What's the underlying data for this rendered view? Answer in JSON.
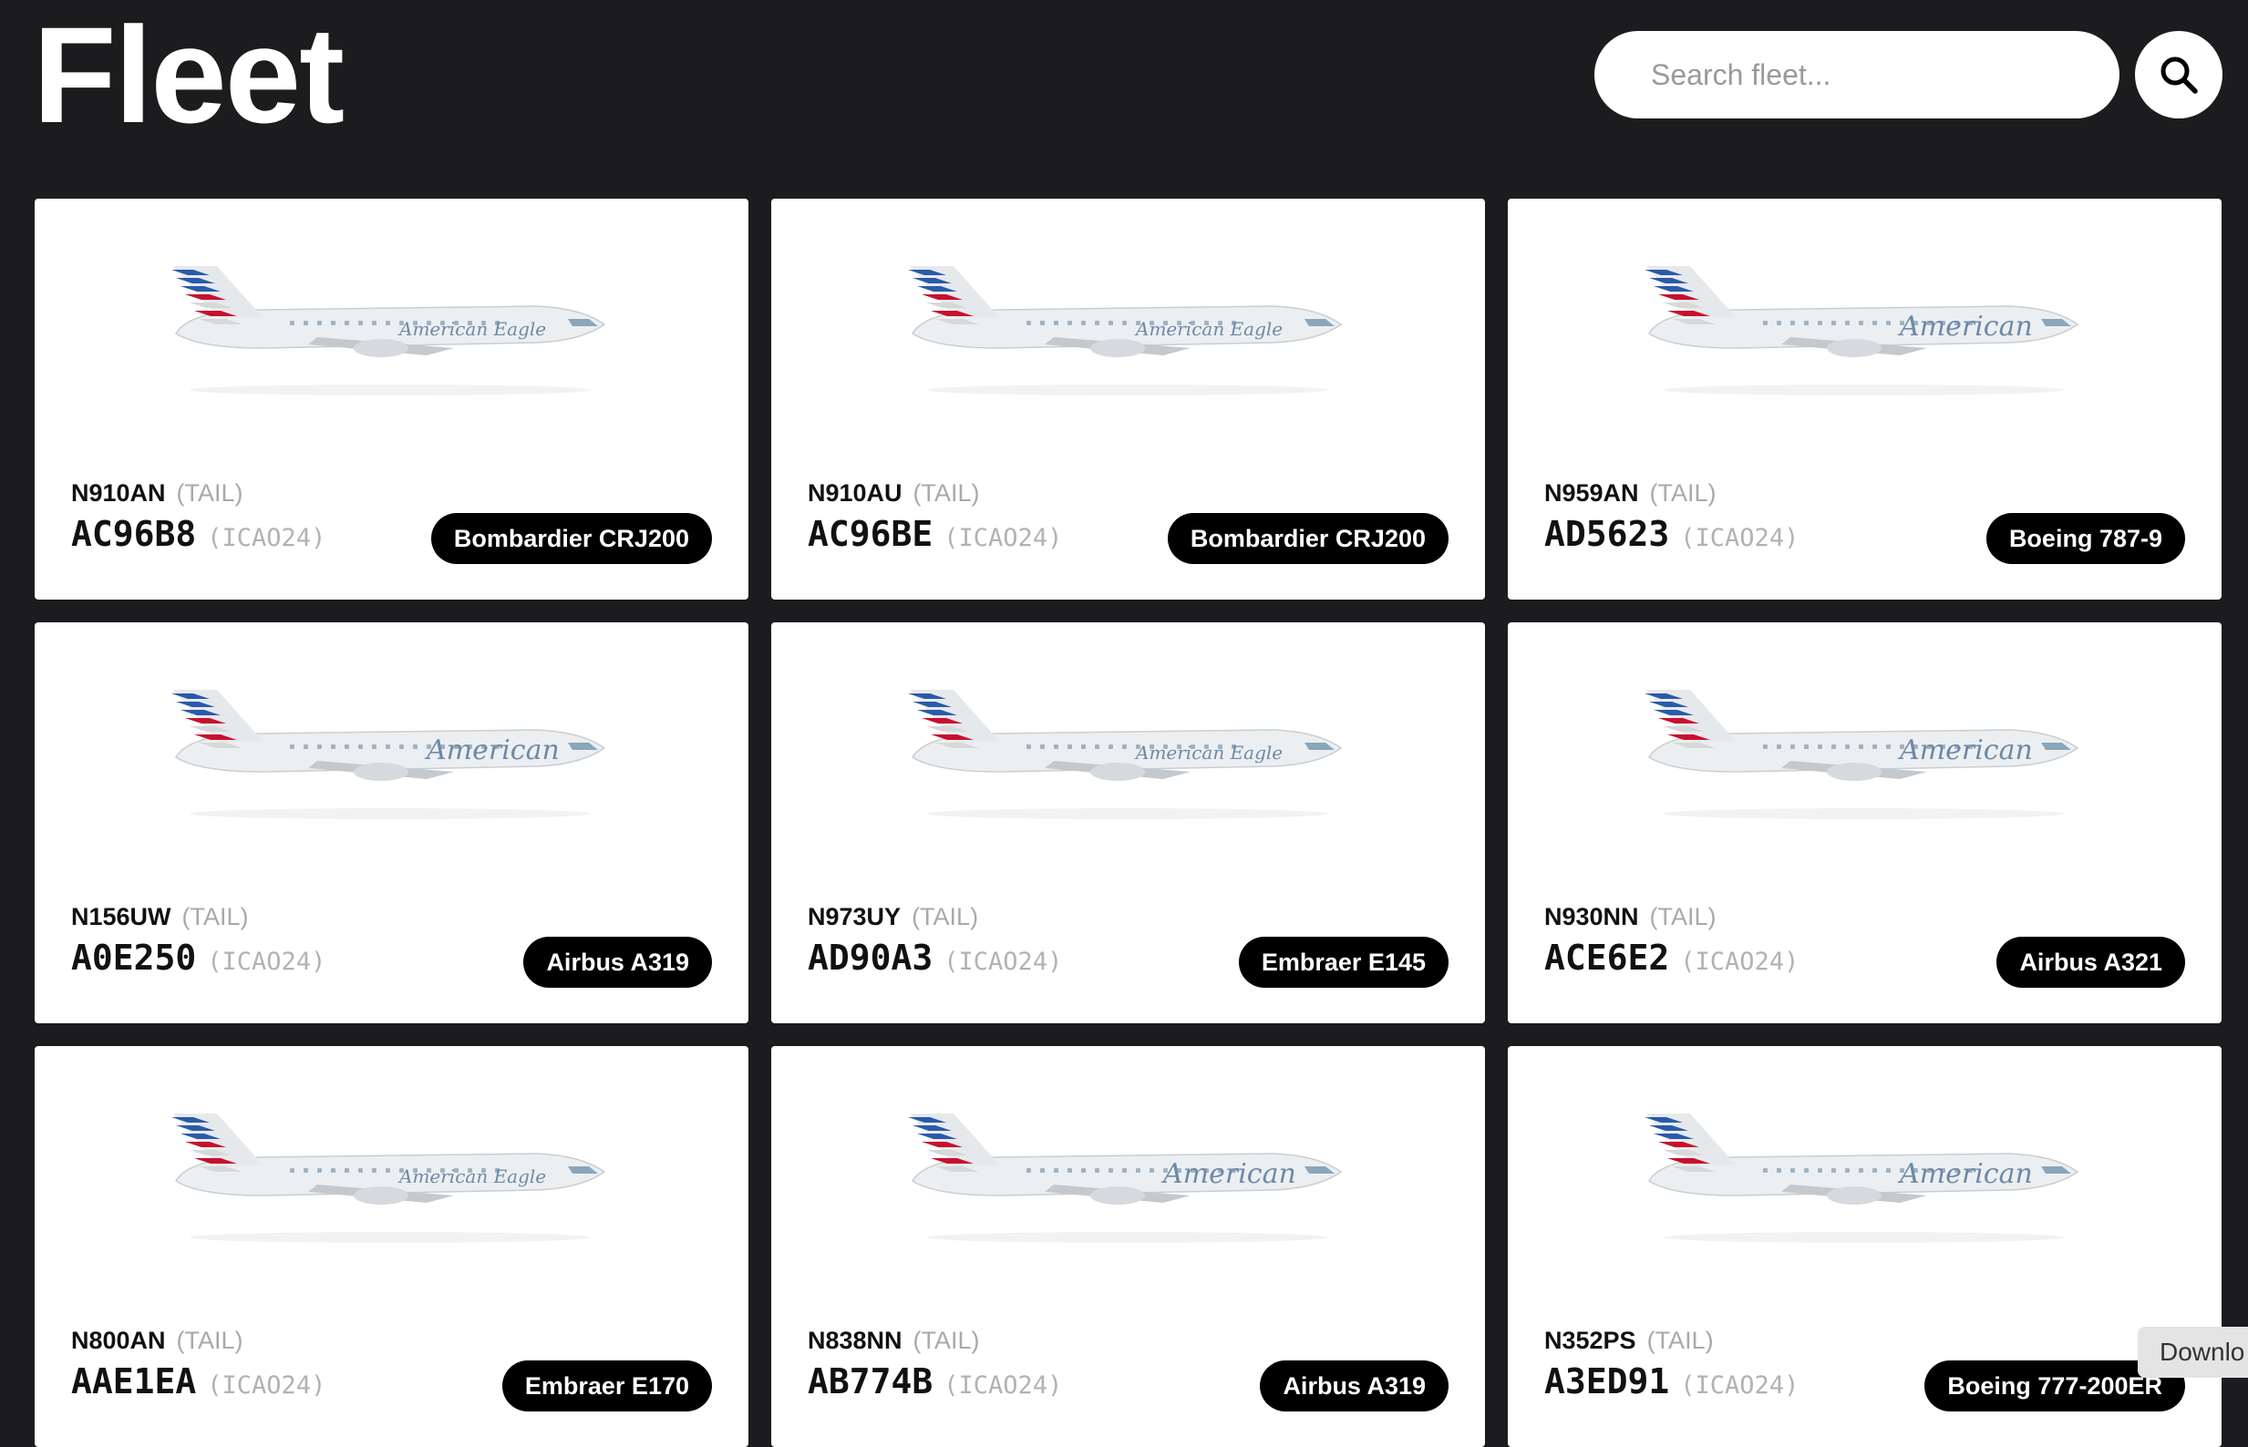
{
  "header": {
    "title": "Fleet",
    "search_placeholder": "Search fleet...",
    "search_icon": "search-icon"
  },
  "tail_suffix": "(TAIL)",
  "icao_suffix": "(ICAO24)",
  "aircraft": [
    {
      "tail": "N910AN",
      "icao": "AC96B8",
      "model": "Bombardier CRJ200",
      "livery": "American Eagle"
    },
    {
      "tail": "N910AU",
      "icao": "AC96BE",
      "model": "Bombardier CRJ200",
      "livery": "American Eagle"
    },
    {
      "tail": "N959AN",
      "icao": "AD5623",
      "model": "Boeing 787-9",
      "livery": "American"
    },
    {
      "tail": "N156UW",
      "icao": "A0E250",
      "model": "Airbus A319",
      "livery": "American"
    },
    {
      "tail": "N973UY",
      "icao": "AD90A3",
      "model": "Embraer E145",
      "livery": "American Eagle"
    },
    {
      "tail": "N930NN",
      "icao": "ACE6E2",
      "model": "Airbus A321",
      "livery": "American"
    },
    {
      "tail": "N800AN",
      "icao": "AAE1EA",
      "model": "Embraer E170",
      "livery": "American Eagle"
    },
    {
      "tail": "N838NN",
      "icao": "AB774B",
      "model": "Airbus A319",
      "livery": "American"
    },
    {
      "tail": "N352PS",
      "icao": "A3ED91",
      "model": "Boeing 777-200ER",
      "livery": "American"
    }
  ],
  "download_label": "Downlo",
  "colors": {
    "background": "#1c1c1e",
    "card": "#ffffff",
    "badge": "#000000",
    "livery_red": "#c8102e",
    "livery_blue": "#2b5aa8"
  }
}
